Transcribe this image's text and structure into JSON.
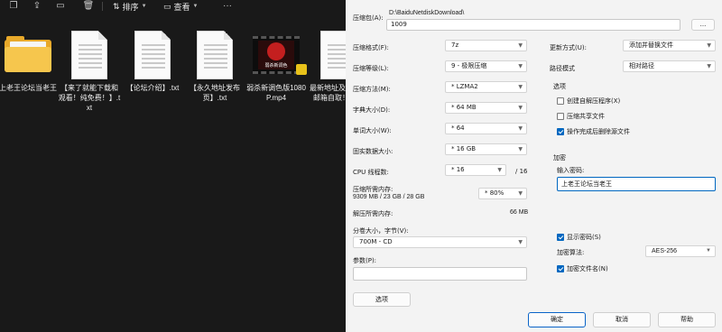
{
  "explorer": {
    "toolbar": {
      "sort_label": "排序",
      "view_label": "查看"
    },
    "files": [
      {
        "name": "上老王论坛当老王",
        "type": "folder"
      },
      {
        "name": "【来了就能下载和观看！纯免费！】.txt",
        "type": "text"
      },
      {
        "name": "【论坛介绍】.txt",
        "type": "text"
      },
      {
        "name": "【永久地址发布页】.txt",
        "type": "text"
      },
      {
        "name": "弱杀新调色版1080P.mp4",
        "type": "video",
        "thumb_text": "弱杀新调色"
      },
      {
        "name": "最新地址及邀请发邮箱自取！！！",
        "type": "text"
      }
    ]
  },
  "dialog": {
    "archive_label": "压缩包(A):",
    "archive_path": "D:\\BaiduNetdiskDownload\\",
    "archive_value": "1009",
    "browse_label": "...",
    "format_label": "压缩格式(F):",
    "format_value": "7z",
    "level_label": "压缩等级(L):",
    "level_value": "9 - 极限压缩",
    "method_label": "压缩方法(M):",
    "method_value": "* LZMA2",
    "dict_label": "字典大小(D):",
    "dict_value": "* 64 MB",
    "word_label": "单词大小(W):",
    "word_value": "* 64",
    "solid_label": "固实数据大小:",
    "solid_value": "* 16 GB",
    "threads_label": "CPU 线程数:",
    "threads_value": "* 16",
    "threads_max": "/ 16",
    "mem_comp_label": "压缩所需内存:",
    "mem_comp_value": "9309 MB / 23 GB / 28 GB",
    "mem_pct_value": "* 80%",
    "mem_decomp_label": "解压所需内存:",
    "mem_decomp_value": "66 MB",
    "split_label": "分卷大小，字节(V):",
    "split_value": "700M - CD",
    "params_label": "参数(P):",
    "params_value": "",
    "options_button": "选项",
    "update_label": "更新方式(U):",
    "update_value": "添加并替换文件",
    "path_mode_label": "路径模式",
    "path_mode_value": "相对路径",
    "options_group": "选项",
    "opt_sfx": "创建自解压程序(X)",
    "opt_shared": "压缩共享文件",
    "opt_delete": "操作完成后删除源文件",
    "enc_group": "加密",
    "pwd_label": "输入密码:",
    "pwd_value": "上老王论坛当老王",
    "show_pwd": "显示密码(S)",
    "enc_method_label": "加密算法:",
    "enc_method_value": "AES-256",
    "enc_names": "加密文件名(N)",
    "ok_button": "确定",
    "cancel_button": "取消",
    "help_button": "帮助"
  }
}
